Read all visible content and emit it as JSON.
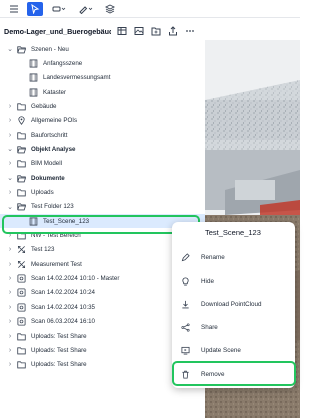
{
  "colors": {
    "accent": "#2563eb",
    "highlight": "#22c55e",
    "selected_bg": "#dbeafe"
  },
  "toolbar": {
    "icons": [
      "cursor-icon",
      "tape-measure-icon",
      "brush-tools-icon",
      "layers-icon"
    ]
  },
  "header": {
    "title": "Demo-Lager_und_Buerogebäude",
    "icons": [
      "table-icon",
      "image-icon",
      "add-folder-icon",
      "share-icon",
      "more-icon"
    ]
  },
  "tree": [
    {
      "label": "Szenen - Neu",
      "icon": "folder-open-icon",
      "chevron": "down",
      "indent": 0,
      "bold": false
    },
    {
      "label": "Anfangsszene",
      "icon": "scene-icon",
      "chevron": "",
      "indent": 1,
      "bold": false
    },
    {
      "label": "Landesvermessungsamt",
      "icon": "scene-icon",
      "chevron": "",
      "indent": 1,
      "bold": false
    },
    {
      "label": "Kataster",
      "icon": "scene-icon",
      "chevron": "",
      "indent": 1,
      "bold": false
    },
    {
      "label": "Gebäude",
      "icon": "folder-icon",
      "chevron": "right",
      "indent": 0,
      "bold": false
    },
    {
      "label": "Allgemeine POIs",
      "icon": "pin-icon",
      "chevron": "right",
      "indent": 0,
      "bold": false
    },
    {
      "label": "Baufortschritt",
      "icon": "folder-icon",
      "chevron": "right",
      "indent": 0,
      "bold": false
    },
    {
      "label": "Objekt Analyse",
      "icon": "folder-open-icon",
      "chevron": "down",
      "indent": 0,
      "bold": true
    },
    {
      "label": "BIM Modell",
      "icon": "folder-icon",
      "chevron": "right",
      "indent": 0,
      "bold": false
    },
    {
      "label": "Dokumente",
      "icon": "folder-open-icon",
      "chevron": "down",
      "indent": 0,
      "bold": true
    },
    {
      "label": "Uploads",
      "icon": "folder-icon",
      "chevron": "right",
      "indent": 0,
      "bold": false
    },
    {
      "label": "Test Folder 123",
      "icon": "folder-open-icon",
      "chevron": "down",
      "indent": 0,
      "bold": false
    },
    {
      "label": "Test_Scene_123",
      "icon": "scene-icon",
      "chevron": "",
      "indent": 1,
      "bold": false,
      "selected": true
    },
    {
      "label": "NW - Test Bereich",
      "icon": "folder-icon",
      "chevron": "right",
      "indent": 0,
      "bold": false
    },
    {
      "label": "Test 123",
      "icon": "measure-icon",
      "chevron": "right",
      "indent": 0,
      "bold": false
    },
    {
      "label": "Measurement Test",
      "icon": "measure-icon",
      "chevron": "right",
      "indent": 0,
      "bold": false
    },
    {
      "label": "Scan 14.02.2024 10:10 - Master",
      "icon": "scan-icon",
      "chevron": "right",
      "indent": 0,
      "bold": false
    },
    {
      "label": "Scan 14.02.2024 10:24",
      "icon": "scan-icon",
      "chevron": "right",
      "indent": 0,
      "bold": false
    },
    {
      "label": "Scan 14.02.2024 10:35",
      "icon": "scan-icon",
      "chevron": "right",
      "indent": 0,
      "bold": false
    },
    {
      "label": "Scan 06.03.2024 16:10",
      "icon": "scan-icon",
      "chevron": "right",
      "indent": 0,
      "bold": false
    },
    {
      "label": "Uploads: Test Share",
      "icon": "folder-icon",
      "chevron": "right",
      "indent": 0,
      "bold": false
    },
    {
      "label": "Uploads: Test Share",
      "icon": "folder-icon",
      "chevron": "right",
      "indent": 0,
      "bold": false
    },
    {
      "label": "Uploads: Test Share",
      "icon": "folder-icon",
      "chevron": "right",
      "indent": 0,
      "bold": false
    }
  ],
  "context_menu": {
    "title": "Test_Scene_123",
    "items": [
      {
        "label": "Rename",
        "icon": "pen-icon"
      },
      {
        "label": "Hide",
        "icon": "bulb-icon"
      },
      {
        "label": "Download PointCloud",
        "icon": "download-icon"
      },
      {
        "label": "Share",
        "icon": "share-icon"
      },
      {
        "label": "Update Scene",
        "icon": "update-scene-icon"
      },
      {
        "label": "Remove",
        "icon": "trash-icon"
      }
    ]
  }
}
